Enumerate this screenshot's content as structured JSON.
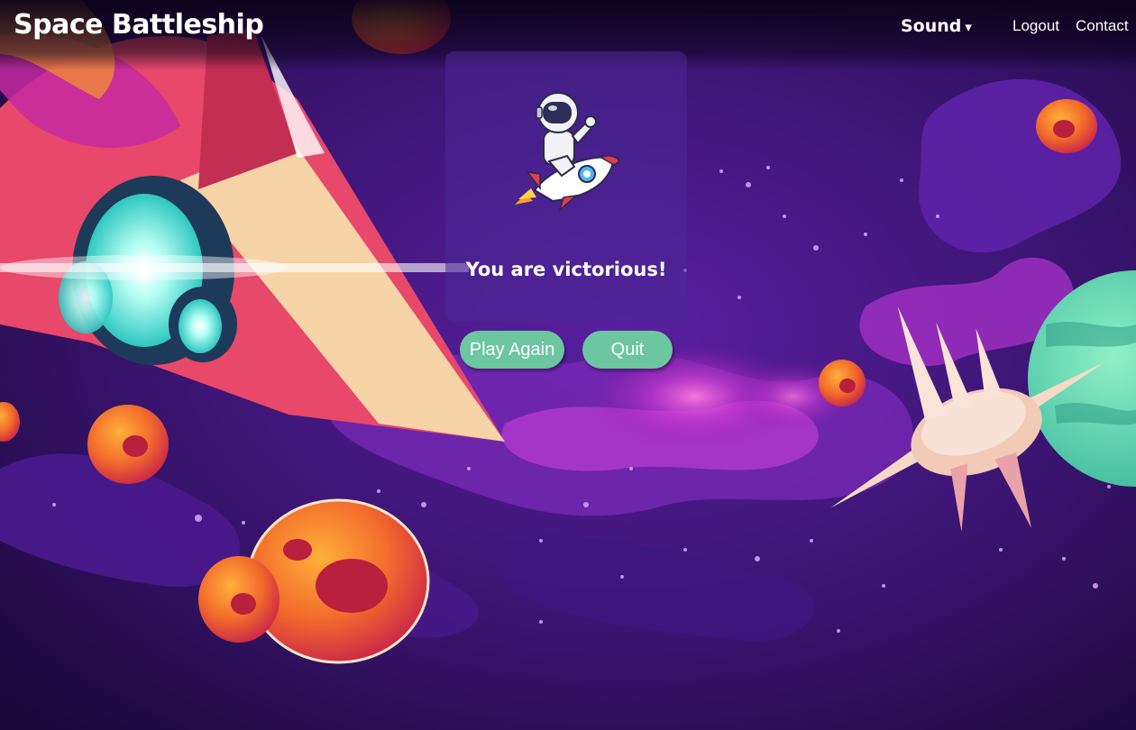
{
  "app": {
    "title": "Space Battleship"
  },
  "nav": {
    "sound_label": "Sound",
    "sound_caret": "▾",
    "logout_label": "Logout",
    "contact_label": "Contact"
  },
  "result": {
    "message": "You are victorious!"
  },
  "actions": {
    "play_again_label": "Play Again",
    "quit_label": "Quit"
  },
  "icons": {
    "hero": "astronaut-on-rocket-icon",
    "sound_toggle": "chevron-down-icon"
  },
  "colors": {
    "button": "#6cc6a0",
    "card": "#4b2896",
    "background": "#2a0f4f",
    "text": "#ffffff"
  }
}
